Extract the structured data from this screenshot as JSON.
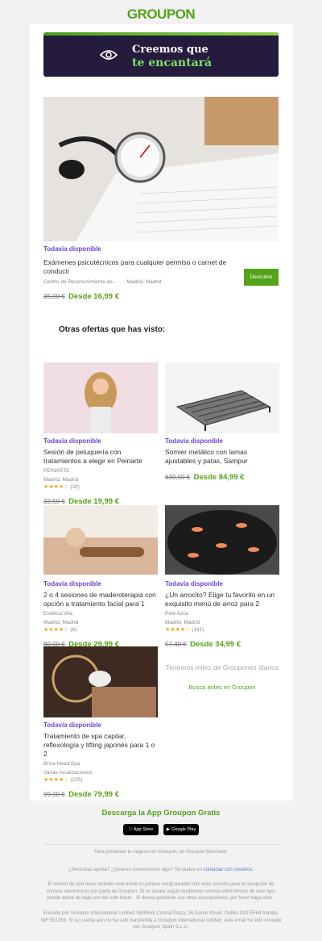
{
  "brand": {
    "logo_text": "GROUPON",
    "accent": "#53a318",
    "available_color": "#6a46d6",
    "hero_bg": "#241b3d"
  },
  "hero": {
    "line1": "Creemos que",
    "line2": "te encantará",
    "icon": "eye-icon"
  },
  "featured": {
    "available": "Todavía disponible",
    "title": "Exámenes psicotécnicos para cualquier permiso o carnet de conducir",
    "merchant": "Centro de Reconocimiento de...",
    "location": "Madrid, Madrid",
    "old_price": "35,00 €",
    "new_price": "Desde 16,99 €",
    "button": "Descubre"
  },
  "section_title": "Otras ofertas que has visto:",
  "deals": [
    {
      "available": "Todavía disponible",
      "title": "Sesión de peluquería con tratamientos a elegir en Peinarte",
      "merchant": "PEINARTE",
      "location": "Madrid, Madrid",
      "stars": "★★★★☆",
      "rating_value": 4.5,
      "reviews": "(33)",
      "old_price": "32,50 €",
      "new_price": "Desde 19,99 €"
    },
    {
      "available": "Todavía disponible",
      "title": "Somier metálico con lamas ajustables y patas, Sampur",
      "merchant": "",
      "location": "",
      "stars": "",
      "reviews": "",
      "old_price": "639,00 €",
      "new_price": "Desde 84,99 €"
    },
    {
      "available": "Todavía disponible",
      "title": "2 o 4 sesiones de maderoterapia con opción a tratamiento facial para 1",
      "merchant": "Estética Vita",
      "location": "Madrid, Madrid",
      "stars": "★★★★☆",
      "rating_value": 4,
      "reviews": "(6)",
      "old_price": "80,00 €",
      "new_price": "Desde 29,99 €"
    },
    {
      "available": "Todavía disponible",
      "title": "¿Un arrocito? Elige tu favorito en un exquisito menú de arroz para 2",
      "merchant": "Petit Azca",
      "location": "Madrid, Madrid",
      "stars": "★★★★☆",
      "rating_value": 4.5,
      "reviews": "(141)",
      "old_price": "57,40 €",
      "new_price": "Desde 34,99 €"
    },
    {
      "available": "Todavía disponible",
      "title": "Tratamiento de spa capilar, reflexología y lifting japonés para 1 o 2",
      "merchant": "Brisa Head Spa",
      "location": "Varias localizaciones",
      "stars": "★★★★☆",
      "rating_value": 4,
      "reviews": "(225)",
      "old_price": "99,00 €",
      "new_price": "Desde 79,99 €"
    }
  ],
  "promo": {
    "text": "Tenemos miles de Groupones diarios",
    "link": "Busca antes en Groupon"
  },
  "app": {
    "heading": "Descarga la App Groupon Gratis",
    "appstore_small": "Download on the",
    "appstore": "App Store",
    "googleplay_small": "GET IT ON",
    "googleplay": "Google Play"
  },
  "footer": {
    "merchant": "Para presentar tu negocio en Groupon, en Groupon Merchant.",
    "help": "¿Necesitas ayuda? ¿Quieres comentarnos algo? No dudes en",
    "help_link": "contactar con nosotros.",
    "reason": "El motivo de que haya recibido este email es porque xxx@ureader.com está suscrito para la recepción de correos electrónicos por parte de Groupon. Si no desea seguir recibiendo correos electrónicos de este tipo, puede darse de baja con tan solo hacer . Si desea gestionar sus otras suscripciones, por favor haga click .",
    "legal": "Enviado por Groupon International Limited, WeWork Central Plaza, 36 Dame Street, Dublin D02 EF64 Irlanda, NIF:501358. Si su cuenta aún no ha sido transferida a Groupon International Limited, este email ha sido enviado por Groupon Spain S.L.U."
  }
}
